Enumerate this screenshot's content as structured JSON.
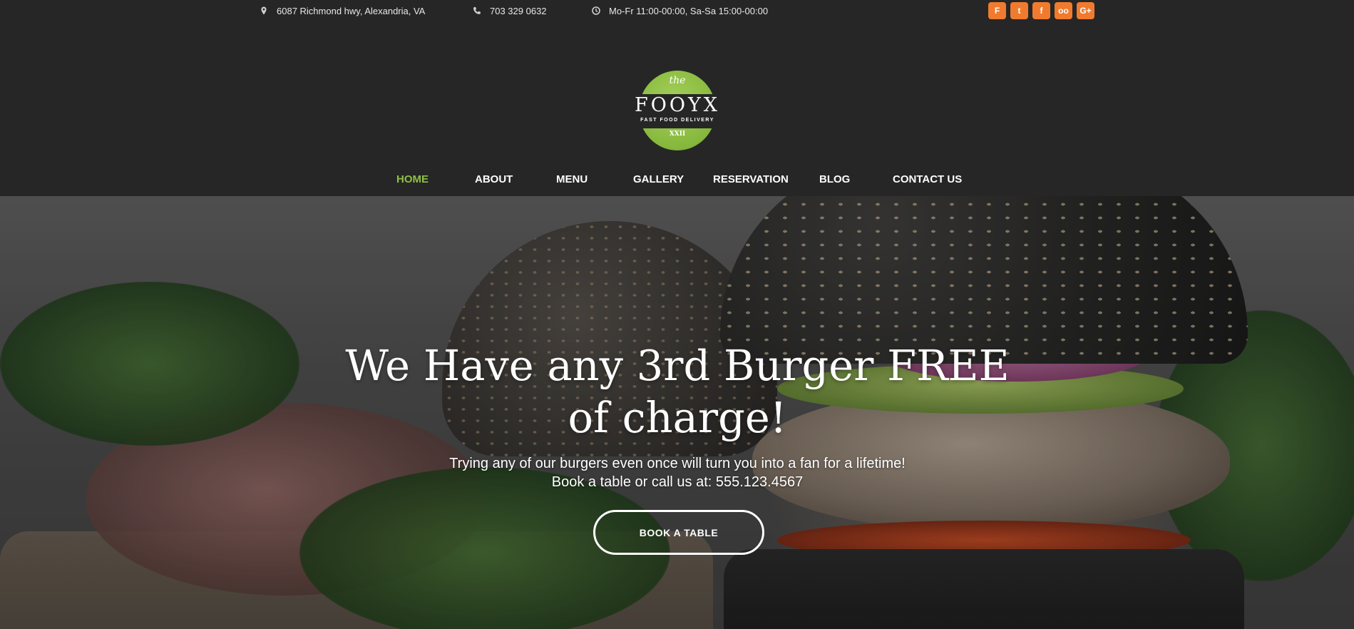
{
  "topbar": {
    "address": "6087 Richmond hwy, Alexandria, VA",
    "phone": "703 329 0632",
    "hours": "Mo-Fr 11:00-00:00, Sa-Sa 15:00-00:00",
    "socials": [
      {
        "icon": "foursquare-icon",
        "glyph": "F"
      },
      {
        "icon": "twitter-icon",
        "glyph": "t"
      },
      {
        "icon": "facebook-icon",
        "glyph": "f"
      },
      {
        "icon": "tripadvisor-icon",
        "glyph": "oo"
      },
      {
        "icon": "google-plus-icon",
        "glyph": "G+"
      }
    ]
  },
  "logo": {
    "the": "the",
    "name": "FOOYX",
    "tagline": "FAST FOOD DELIVERY",
    "roman": "XXII"
  },
  "nav": {
    "items": [
      {
        "label": "HOME",
        "active": true
      },
      {
        "label": "ABOUT",
        "active": false
      },
      {
        "label": "MENU",
        "active": false
      },
      {
        "label": "GALLERY",
        "active": false
      },
      {
        "label": "RESERVATION",
        "active": false
      },
      {
        "label": "BLOG",
        "active": false
      },
      {
        "label": "CONTACT US",
        "active": false
      }
    ]
  },
  "hero": {
    "title_line1": "We Have any 3rd Burger FREE",
    "title_line2": "of charge!",
    "subtitle_line1": "Trying any of our burgers even once will turn you into a fan for a lifetime!",
    "subtitle_line2": "Book a table or call us at: 555.123.4567",
    "cta_label": "BOOK A TABLE"
  },
  "colors": {
    "accent_green": "#8fbf45",
    "social_orange": "#f07b2e",
    "header_bg": "#262626"
  }
}
